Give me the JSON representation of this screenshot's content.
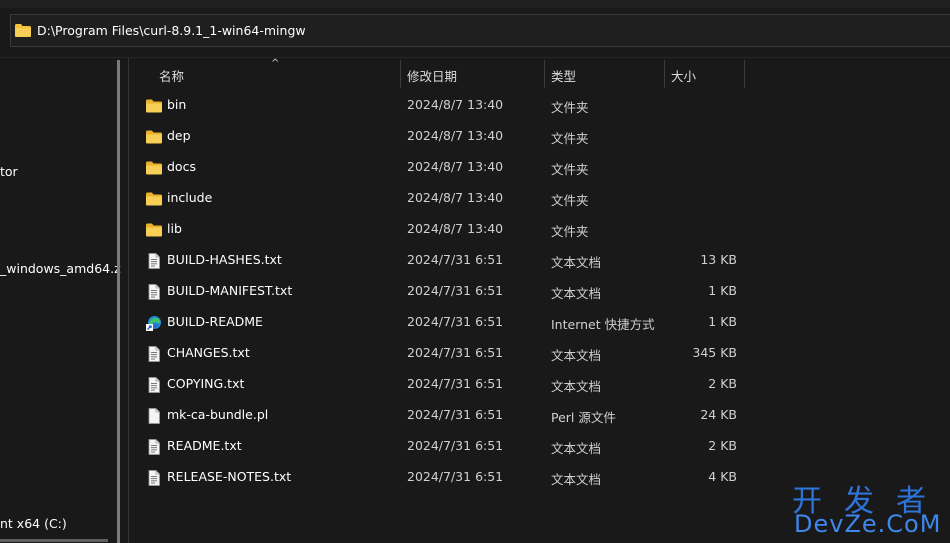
{
  "address": {
    "path": "D:\\Program Files\\curl-8.9.1_1-win64-mingw"
  },
  "nav": {
    "items": [
      {
        "label": "tor"
      },
      {
        "label": "_windows_amd64.z"
      },
      {
        "label": "nt x64 (C:)"
      }
    ]
  },
  "columns": {
    "name": "名称",
    "date": "修改日期",
    "type": "类型",
    "size": "大小",
    "sort_indicator": "^"
  },
  "files": [
    {
      "name": "bin",
      "date": "2024/8/7 13:40",
      "type": "文件夹",
      "size": "",
      "icon": "folder-icon"
    },
    {
      "name": "dep",
      "date": "2024/8/7 13:40",
      "type": "文件夹",
      "size": "",
      "icon": "folder-icon"
    },
    {
      "name": "docs",
      "date": "2024/8/7 13:40",
      "type": "文件夹",
      "size": "",
      "icon": "folder-icon"
    },
    {
      "name": "include",
      "date": "2024/8/7 13:40",
      "type": "文件夹",
      "size": "",
      "icon": "folder-icon"
    },
    {
      "name": "lib",
      "date": "2024/8/7 13:40",
      "type": "文件夹",
      "size": "",
      "icon": "folder-icon"
    },
    {
      "name": "BUILD-HASHES.txt",
      "date": "2024/7/31 6:51",
      "type": "文本文档",
      "size": "13 KB",
      "icon": "text-file-icon"
    },
    {
      "name": "BUILD-MANIFEST.txt",
      "date": "2024/7/31 6:51",
      "type": "文本文档",
      "size": "1 KB",
      "icon": "text-file-icon"
    },
    {
      "name": "BUILD-README",
      "date": "2024/7/31 6:51",
      "type": "Internet 快捷方式",
      "size": "1 KB",
      "icon": "edge-shortcut-icon"
    },
    {
      "name": "CHANGES.txt",
      "date": "2024/7/31 6:51",
      "type": "文本文档",
      "size": "345 KB",
      "icon": "text-file-icon"
    },
    {
      "name": "COPYING.txt",
      "date": "2024/7/31 6:51",
      "type": "文本文档",
      "size": "2 KB",
      "icon": "text-file-icon"
    },
    {
      "name": "mk-ca-bundle.pl",
      "date": "2024/7/31 6:51",
      "type": "Perl 源文件",
      "size": "24 KB",
      "icon": "blank-file-icon"
    },
    {
      "name": "README.txt",
      "date": "2024/7/31 6:51",
      "type": "文本文档",
      "size": "2 KB",
      "icon": "text-file-icon"
    },
    {
      "name": "RELEASE-NOTES.txt",
      "date": "2024/7/31 6:51",
      "type": "文本文档",
      "size": "4 KB",
      "icon": "text-file-icon"
    }
  ],
  "watermark": {
    "line1": "开发者",
    "line2": "DevZe.CoM"
  },
  "colors": {
    "background": "#191919",
    "folder": "#f3c13a",
    "watermark": "#2e74d8"
  }
}
